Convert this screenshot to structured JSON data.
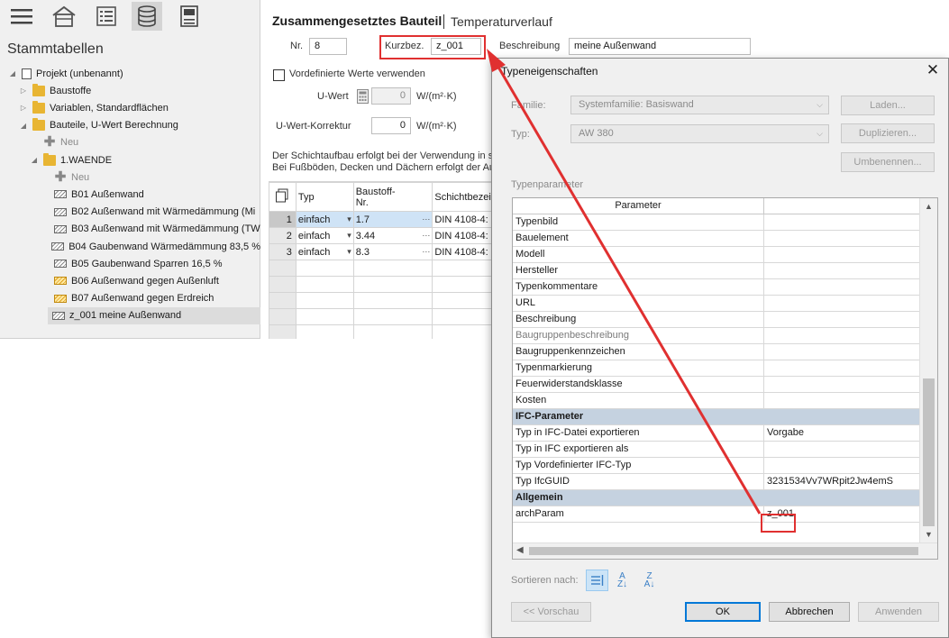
{
  "left_panel": {
    "title": "Stammtabellen",
    "toolbar_icons": [
      "menu-icon",
      "building-icon",
      "list-icon",
      "database-icon",
      "calculator-icon"
    ],
    "tree": [
      {
        "label": "Projekt (unbenannt)",
        "icon": "document-icon",
        "level": 0,
        "expander": "expanded"
      },
      {
        "label": "Baustoffe",
        "icon": "folder-icon",
        "level": 1,
        "expander": "collapsed"
      },
      {
        "label": "Variablen, Standardflächen",
        "icon": "folder-icon",
        "level": 1,
        "expander": "collapsed"
      },
      {
        "label": "Bauteile, U-Wert Berechnung",
        "icon": "folder-icon",
        "level": 1,
        "expander": "expanded"
      },
      {
        "label": "Neu",
        "icon": "plus-icon",
        "level": 2,
        "expander": "none"
      },
      {
        "label": "1.WAENDE",
        "icon": "folder-icon",
        "level": 2,
        "expander": "expanded"
      },
      {
        "label": "Neu",
        "icon": "plus-icon",
        "level": 3,
        "expander": "none"
      },
      {
        "label": "B01 Außenwand",
        "icon": "wall-icon",
        "level": 3,
        "expander": "none"
      },
      {
        "label": "B02 Außenwand mit Wärmedämmung (Mi",
        "icon": "wall-icon",
        "level": 3,
        "expander": "none"
      },
      {
        "label": "B03 Außenwand mit Wärmedämmung (TW",
        "icon": "wall-icon",
        "level": 3,
        "expander": "none"
      },
      {
        "label": "B04 Gaubenwand Wärmedämmung 83,5 %",
        "icon": "wall-icon",
        "level": 3,
        "expander": "none"
      },
      {
        "label": "B05 Gaubenwand Sparren 16,5 %",
        "icon": "wall-icon",
        "level": 3,
        "expander": "none"
      },
      {
        "label": "B06 Außenwand gegen Außenluft",
        "icon": "wall-locked-icon",
        "level": 3,
        "expander": "none"
      },
      {
        "label": "B07 Außenwand gegen Erdreich",
        "icon": "wall-locked-icon",
        "level": 3,
        "expander": "none"
      },
      {
        "label": "z_001 meine Außenwand",
        "icon": "wall-icon",
        "level": 3,
        "expander": "none",
        "selected": true
      }
    ]
  },
  "main": {
    "title": "Zusammengesetztes Bauteil",
    "subtitle": "Temperaturverlauf",
    "nr_label": "Nr.",
    "nr_value": "8",
    "kurzbez_label": "Kurzbez.",
    "kurzbez_value": "z_001",
    "beschreibung_label": "Beschreibung",
    "beschreibung_value": "meine Außenwand",
    "vordefiniert_label": "Vordefinierte Werte verwenden",
    "uwert_label": "U-Wert",
    "uwert_value": "0",
    "uwert_unit": "W/(m²·K)",
    "korrektur_label": "U-Wert-Korrektur",
    "korrektur_value": "0",
    "korrektur_unit": "W/(m²·K)",
    "info_line1": "Der Schichtaufbau erfolgt bei der Verwendung in se",
    "info_line2": "Bei Fußböden, Decken und Dächern erfolgt der Auf",
    "layers": {
      "headers": [
        "Typ",
        "Baustoff-\nNr.",
        "Schichtbezei"
      ],
      "rows": [
        {
          "nr": "1",
          "typ": "einfach",
          "baustoff": "1.7",
          "schicht": "DIN 4108-4:"
        },
        {
          "nr": "2",
          "typ": "einfach",
          "baustoff": "3.44",
          "schicht": "DIN 4108-4:"
        },
        {
          "nr": "3",
          "typ": "einfach",
          "baustoff": "8.3",
          "schicht": "DIN 4108-4:"
        }
      ]
    }
  },
  "dialog": {
    "title": "Typeneigenschaften",
    "familie_label": "Familie:",
    "familie_value": "Systemfamilie: Basiswand",
    "typ_label": "Typ:",
    "typ_value": "AW 380",
    "btn_laden": "Laden...",
    "btn_duplizieren": "Duplizieren...",
    "btn_umbenennen": "Umbenennen...",
    "typenparameter_label": "Typenparameter",
    "col_parameter": "Parameter",
    "col_wert": "",
    "rows": [
      {
        "name": "Typenbild",
        "value": "",
        "kind": "normal"
      },
      {
        "name": "Bauelement",
        "value": "",
        "kind": "normal"
      },
      {
        "name": "Modell",
        "value": "",
        "kind": "normal"
      },
      {
        "name": "Hersteller",
        "value": "",
        "kind": "normal"
      },
      {
        "name": "Typenkommentare",
        "value": "",
        "kind": "normal"
      },
      {
        "name": "URL",
        "value": "",
        "kind": "normal"
      },
      {
        "name": "Beschreibung",
        "value": "",
        "kind": "normal"
      },
      {
        "name": "Baugruppenbeschreibung",
        "value": "",
        "kind": "dim"
      },
      {
        "name": "Baugruppenkennzeichen",
        "value": "",
        "kind": "normal"
      },
      {
        "name": "Typenmarkierung",
        "value": "",
        "kind": "normal"
      },
      {
        "name": "Feuerwiderstandsklasse",
        "value": "",
        "kind": "normal"
      },
      {
        "name": "Kosten",
        "value": "",
        "kind": "normal"
      },
      {
        "name": "IFC-Parameter",
        "value": "",
        "kind": "group"
      },
      {
        "name": "Typ in IFC-Datei exportieren",
        "value": "Vorgabe",
        "kind": "normal"
      },
      {
        "name": "Typ in IFC exportieren als",
        "value": "",
        "kind": "normal"
      },
      {
        "name": "Typ Vordefinierter IFC-Typ",
        "value": "",
        "kind": "normal"
      },
      {
        "name": "Typ IfcGUID",
        "value": "3231534Vv7WRpit2Jw4emS",
        "kind": "normal"
      },
      {
        "name": "Allgemein",
        "value": "",
        "kind": "group"
      },
      {
        "name": "archParam",
        "value": "z_001",
        "kind": "normal"
      }
    ],
    "sort_label": "Sortieren nach:",
    "btn_vorschau": "<< Vorschau",
    "btn_ok": "OK",
    "btn_abbrechen": "Abbrechen",
    "btn_anwenden": "Anwenden"
  },
  "colors": {
    "highlight_red": "#e03030",
    "group_row_bg": "#c5d2e0",
    "selection_blue": "#cfe3f6"
  }
}
